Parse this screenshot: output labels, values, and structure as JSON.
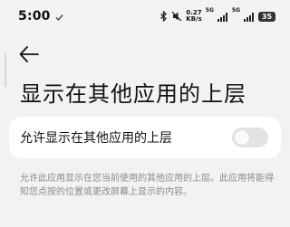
{
  "status_bar": {
    "time": "5:00",
    "net_speed_value": "0.27",
    "net_speed_unit": "KB/s",
    "signal_1_label": "5G",
    "signal_2_label": "5G",
    "battery_level": "35",
    "icons": [
      "vpn-check-icon",
      "bluetooth-icon",
      "mute-icon",
      "signal-icon",
      "battery-icon"
    ]
  },
  "header": {
    "back_icon": "back-arrow-icon"
  },
  "page": {
    "title": "显示在其他应用的上层"
  },
  "setting": {
    "label": "允许显示在其他应用的上层",
    "enabled": false
  },
  "description": "允许此应用显示在您当前使用的其他应用的上层。此应用将能得知您点按的位置或更改屏幕上显示的内容。",
  "colors": {
    "background": "#f2f2f2",
    "card": "#ffffff",
    "toggle_off": "#e3e3e3",
    "secondary_text": "#8a8a8a"
  }
}
